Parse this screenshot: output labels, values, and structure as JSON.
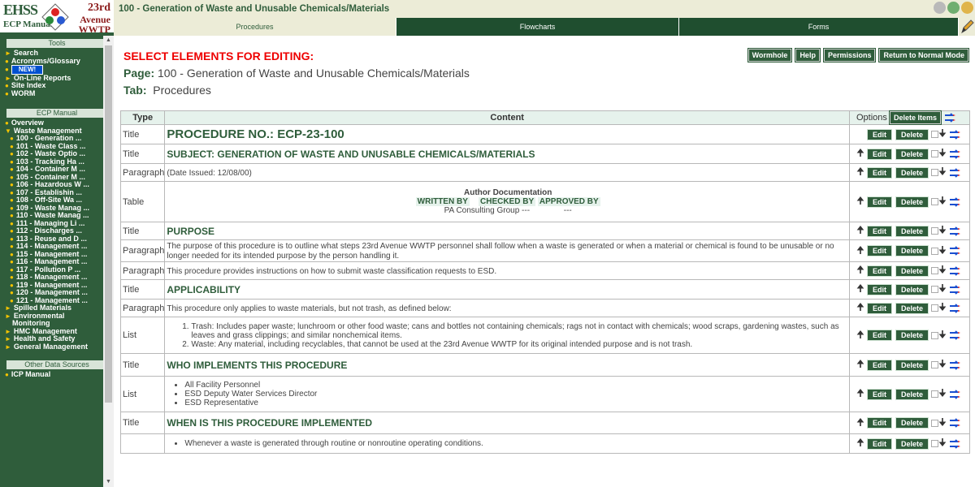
{
  "logo": {
    "left_top": "EHSS",
    "left_bottom": "ECP Manual",
    "right_1": "23rd",
    "right_2": "Avenue",
    "right_3": "WWTP"
  },
  "header": {
    "title": "100 - Generation of Waste and Unusable Chemicals/Materials"
  },
  "tabs": [
    {
      "label": "Procedures"
    },
    {
      "label": "Flowcharts"
    },
    {
      "label": "Forms"
    }
  ],
  "sidebar": {
    "tools_heading": "Tools",
    "tools": [
      "Search",
      "Acronyms/Glossary",
      "NEW!",
      "On-Line Reports",
      "Site Index",
      "WORM"
    ],
    "ecp_heading": "ECP Manual",
    "ecp_items": [
      "Overview",
      "Waste Management"
    ],
    "waste_items": [
      "100 - Generation ...",
      "101 - Waste Class ...",
      "102 - Waste Optio ...",
      "103 - Tracking Ha ...",
      "104 - Container M ...",
      "105 - Container M ...",
      "106 - Hazardous W ...",
      "107 - Establishin ...",
      "108 - Off-Site Wa ...",
      "109 - Waste Manag ...",
      "110 - Waste Manag ...",
      "111 - Managing Li ...",
      "112 - Discharges ...",
      "113 - Reuse and D ...",
      "114 - Management ...",
      "115 - Management ...",
      "116 - Management ...",
      "117 - Pollution P ...",
      "118 - Management ...",
      "119 - Management ...",
      "120 - Management ...",
      "121 - Management ..."
    ],
    "more_items": [
      "Spilled Materials",
      "Environmental",
      "Monitoring",
      "HMC Management",
      "Health and Safety",
      "General Management"
    ],
    "other_heading": "Other Data Sources",
    "other_items": [
      "ICP Manual"
    ]
  },
  "main": {
    "select_title": "SELECT ELEMENTS FOR EDITING:",
    "page_label": "Page:",
    "page_value": "100 - Generation of Waste and Unusable Chemicals/Materials",
    "tab_label": "Tab:",
    "tab_value": "Procedures",
    "actions": [
      "Wormhole",
      "Help",
      "Permissions",
      "Return to Normal Mode"
    ]
  },
  "table": {
    "col_type": "Type",
    "col_content": "Content",
    "col_options": "Options",
    "delete_items": "Delete Items",
    "edit_label": "Edit",
    "delete_label": "Delete",
    "rows": [
      {
        "type": "Title",
        "text": "PROCEDURE NO.:   ECP-23-100"
      },
      {
        "type": "Title",
        "text": "SUBJECT:  GENERATION OF WASTE AND UNUSABLE CHEMICALS/MATERIALS"
      },
      {
        "type": "Paragraph",
        "text": "(Date Issued: 12/08/00)"
      },
      {
        "type": "Table",
        "heading": "Author Documentation",
        "c1": "WRITTEN BY",
        "c2": "CHECKED BY",
        "c3": "APPROVED BY",
        "v1": "PA Consulting Group ---",
        "v2": "---"
      },
      {
        "type": "Title",
        "text": "PURPOSE"
      },
      {
        "type": "Paragraph",
        "text": "The purpose of this procedure is to outline what steps 23rd Avenue WWTP personnel shall follow when a waste is generated or when a material or chemical is found to be unusable or no longer needed for its intended purpose by the person handling it."
      },
      {
        "type": "Paragraph",
        "text": "This procedure provides instructions on how to submit waste classification requests to ESD."
      },
      {
        "type": "Title",
        "text": "APPLICABILITY"
      },
      {
        "type": "Paragraph",
        "text": "This procedure only applies to waste materials, but not trash, as defined below:"
      },
      {
        "type": "List",
        "items": [
          "Trash: Includes paper waste; lunchroom or other food waste; cans and bottles not containing chemicals; rags not in contact with chemicals; wood scraps, gardening wastes, such as leaves and grass clippings; and similar nonchemical items.",
          "Waste: Any material, including recyclables, that cannot be used at the 23rd Avenue WWTP for its original intended purpose and is not trash."
        ]
      },
      {
        "type": "Title",
        "text": "WHO IMPLEMENTS THIS PROCEDURE"
      },
      {
        "type": "List",
        "items": [
          "All Facility Personnel",
          "ESD Deputy Water Services Director",
          "ESD Representative"
        ]
      },
      {
        "type": "Title",
        "text": "WHEN IS THIS PROCEDURE IMPLEMENTED"
      },
      {
        "type": "",
        "items": [
          "Whenever a waste is generated through routine or nonroutine operating conditions."
        ]
      }
    ]
  },
  "colors": {
    "brand_green": "#2f5d3b",
    "dark_tab": "#1f4e2f",
    "header_bg": "#ececd7",
    "alert_red": "#e00000",
    "bullet_yellow": "#f3c300"
  }
}
